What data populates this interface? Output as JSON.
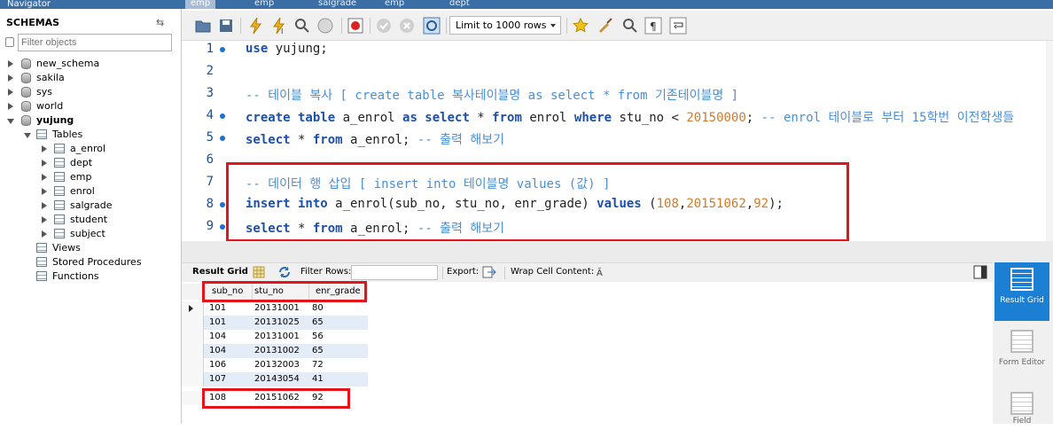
{
  "navigator": {
    "title": "Navigator",
    "schemas_label": "SCHEMAS",
    "filter_placeholder": "Filter objects",
    "schemas": [
      "new_schema",
      "sakila",
      "sys",
      "world",
      "yujung"
    ],
    "tables_label": "Tables",
    "tables": [
      "a_enrol",
      "dept",
      "emp",
      "enrol",
      "salgrade",
      "student",
      "subject"
    ],
    "views_label": "Views",
    "procedures_label": "Stored Procedures",
    "functions_label": "Functions"
  },
  "tabs": [
    "emp",
    "emp",
    "salgrade",
    "emp",
    "dept"
  ],
  "toolbar": {
    "limit_label": "Limit to 1000 rows"
  },
  "editor": {
    "line_numbers": [
      "1",
      "2",
      "3",
      "4",
      "5",
      "6",
      "7",
      "8",
      "9"
    ],
    "l1": {
      "kw": "use",
      "rest": " yujung;"
    },
    "l3": {
      "comment": "-- 테이블 복사 [ create table 복사테이블명 as select * from 기존테이블명 ]"
    },
    "l4": {
      "k1": "create table",
      "t1": " a_enrol ",
      "k2": "as select",
      "t2": " * ",
      "k3": "from",
      "t3": " enrol ",
      "k4": "where",
      "t4": " stu_no < ",
      "n1": "20150000",
      "t5": "; ",
      "c1": "-- enrol 테이블로 부터 15학번 이전학생들"
    },
    "l5": {
      "k1": "select",
      "t1": " * ",
      "k2": "from",
      "t2": " a_enrol; ",
      "c1": "-- 출력 해보기"
    },
    "l7": {
      "comment": "-- 데이터 행 삽입 [ insert into 테이블명 values (값) ]"
    },
    "l8": {
      "k1": "insert into",
      "t1": " a_enrol(sub_no, stu_no, enr_grade) ",
      "k2": "values",
      "t2": " (",
      "n1": "108",
      "t3": ",",
      "n2": "20151062",
      "t4": ",",
      "n3": "92",
      "t5": ");"
    },
    "l9": {
      "k1": "select",
      "t1": " * ",
      "k2": "from",
      "t2": " a_enrol; ",
      "c1": "-- 출력 해보기"
    }
  },
  "result": {
    "result_grid_label": "Result Grid",
    "filter_rows_label": "Filter Rows:",
    "export_label": "Export:",
    "wrap_label": "Wrap Cell Content:",
    "columns": [
      "sub_no",
      "stu_no",
      "enr_grade"
    ],
    "rows": [
      [
        "101",
        "20131001",
        "80"
      ],
      [
        "101",
        "20131025",
        "65"
      ],
      [
        "104",
        "20131001",
        "56"
      ],
      [
        "104",
        "20131002",
        "65"
      ],
      [
        "106",
        "20132003",
        "72"
      ],
      [
        "107",
        "20143054",
        "41"
      ],
      [
        "108",
        "20151062",
        "92"
      ]
    ]
  },
  "side_panel": {
    "result_grid": "Result Grid",
    "form_editor": "Form Editor",
    "field": "Field"
  },
  "colors": {
    "highlight": "#e5141b",
    "keyword": "#1d4fa8",
    "comment": "#4a8fd6",
    "number": "#d17a2b",
    "accent": "#1b7fd4"
  }
}
